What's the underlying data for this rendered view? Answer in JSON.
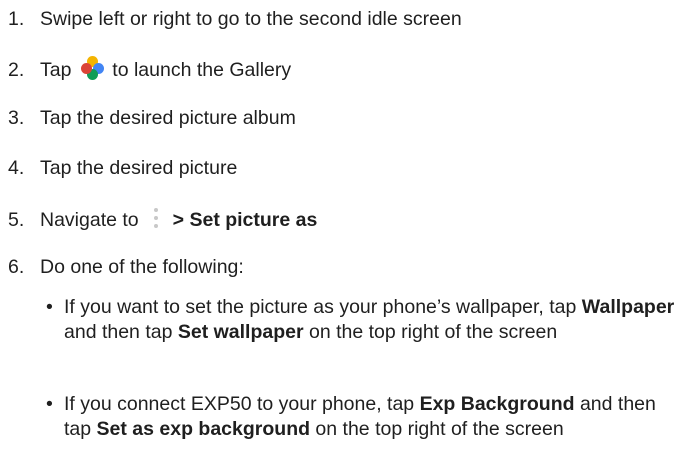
{
  "steps": [
    {
      "num": "1.",
      "text": "Swipe left or right to go to the second idle screen"
    },
    {
      "num": "2.",
      "pre": "Tap",
      "icon": "gallery-app-icon",
      "post": "to launch the Gallery"
    },
    {
      "num": "3.",
      "text": "Tap the desired picture album"
    },
    {
      "num": "4.",
      "text": "Tap the desired picture"
    },
    {
      "num": "5.",
      "pre": "Navigate to",
      "icon": "more-options-icon",
      "bold": "> Set picture as"
    },
    {
      "num": "6.",
      "text": "Do one of the following:"
    }
  ],
  "bullets": [
    {
      "marker": "•",
      "p1": "If you want to set the picture as your phone’s wallpaper, tap ",
      "b1": "Wallpaper",
      "p2": " and then tap ",
      "b2": "Set wallpaper",
      "p3": " on the top right of the screen"
    },
    {
      "marker": "•",
      "p1": "If you connect EXP50 to your phone, tap ",
      "b1": "Exp Background",
      "p2": " and then tap ",
      "b2": "Set as exp background",
      "p3": " on the top right of the screen"
    }
  ]
}
